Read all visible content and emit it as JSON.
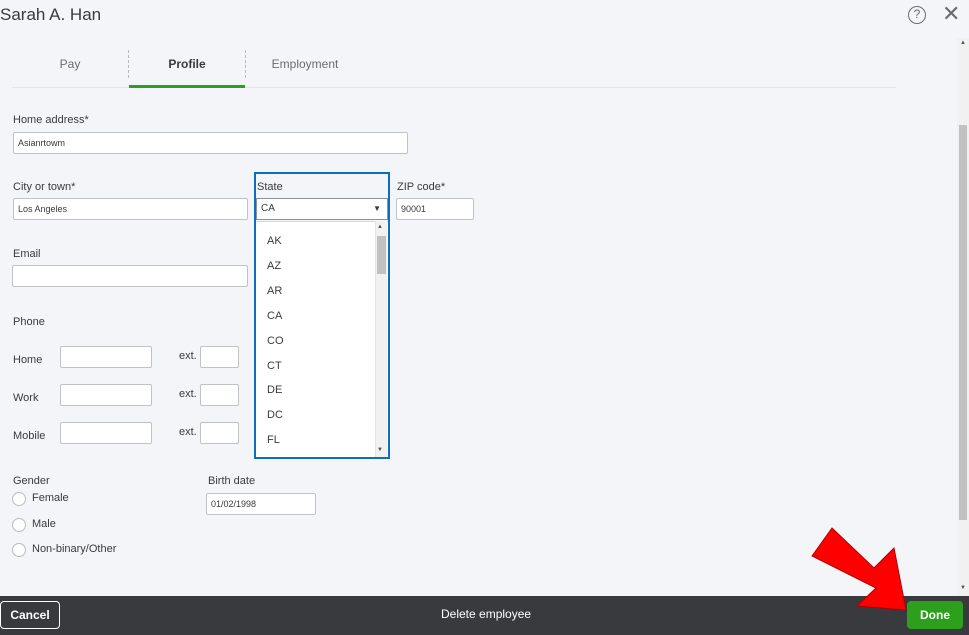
{
  "header": {
    "title": "Sarah A. Han",
    "help_glyph": "?",
    "close_glyph": "✕"
  },
  "tabs": [
    {
      "label": "Pay"
    },
    {
      "label": "Profile",
      "active": true
    },
    {
      "label": "Employment"
    }
  ],
  "form": {
    "home_address": {
      "label": "Home address*",
      "value": "Asianrtowm"
    },
    "city": {
      "label": "City or town*",
      "value": "Los Angeles"
    },
    "state": {
      "label": "State",
      "value": "CA",
      "caret": "▼",
      "options": [
        "AK",
        "AZ",
        "AR",
        "CA",
        "CO",
        "CT",
        "DE",
        "DC",
        "FL"
      ]
    },
    "zip": {
      "label": "ZIP code*",
      "value": "90001"
    },
    "email": {
      "label": "Email",
      "value": ""
    },
    "phone": {
      "label": "Phone",
      "rows": [
        {
          "label": "Home",
          "ext_label": "ext."
        },
        {
          "label": "Work",
          "ext_label": "ext."
        },
        {
          "label": "Mobile",
          "ext_label": "ext."
        }
      ]
    },
    "gender": {
      "label": "Gender",
      "options": [
        "Female",
        "Male",
        "Non-binary/Other"
      ]
    },
    "birth_date": {
      "label": "Birth date",
      "value": "01/02/1998"
    }
  },
  "footer": {
    "cancel_label": "Cancel",
    "delete_label": "Delete employee",
    "done_label": "Done"
  },
  "colors": {
    "accent": "#2ca01c",
    "highlight_border": "#0a6fbf",
    "footer_bg": "#393a3d",
    "arrow": "#ff0000"
  },
  "icons": {
    "help": "help-circle-icon",
    "close": "close-icon",
    "arrow": "red-arrow-annotation"
  }
}
